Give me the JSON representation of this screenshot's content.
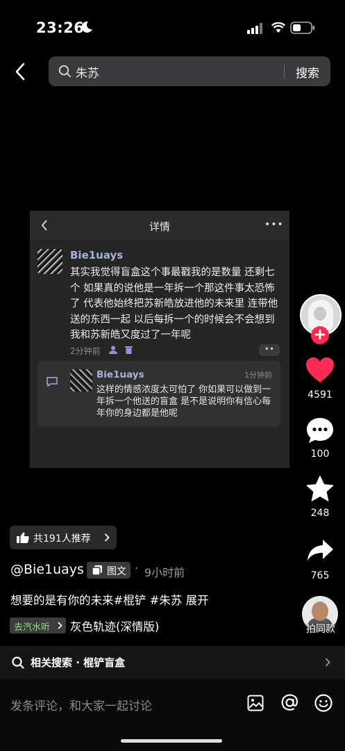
{
  "status_bar": {
    "time": "23:26"
  },
  "search": {
    "query": "朱苏",
    "button": "搜索"
  },
  "embedded_screenshot": {
    "title": "详情",
    "more": "•••",
    "comment": {
      "username": "Bie1uays",
      "text": "其实我觉得盲盒这个事最戳我的是数量 还剩七个 如果真的说他是一年拆一个那这件事太恐怖了 代表他始终把苏新皓放进他的未来里 连带他送的东西一起 以后每拆一个的时候会不会想到我和苏新皓又度过了一年呢",
      "time": "2分钟前",
      "more": "••"
    },
    "reply": {
      "username": "Bie1uays",
      "time": "1分钟前",
      "text": "这样的情感浓度太可怕了 你如果可以做到一年拆一个他送的盲盒 是不是说明你有信心每年你的身边都是他呢"
    }
  },
  "actions": {
    "likes": "4591",
    "comments": "100",
    "favorites": "248",
    "shares": "765"
  },
  "recommend": {
    "label": "共191人推荐"
  },
  "post": {
    "author": "@Bie1uays",
    "type_badge": "图文",
    "dot": "·",
    "time_ago": "9小时前",
    "description": "想要的是有你的未来#棍铲 #朱苏  展开"
  },
  "music": {
    "tag": "去汽水听",
    "song": "灰色轨迹(深情版)",
    "use_label": "拍同款"
  },
  "related_search": {
    "label": "相关搜索 · 棍铲盲盒"
  },
  "comment_bar": {
    "placeholder": "发条评论，和大家一起讨论"
  },
  "colors": {
    "like": "#fe2c55",
    "username": "#a9b3d6",
    "music_tag": "#8fe08a"
  },
  "icons": [
    "moon-icon",
    "signal-icon",
    "wifi-icon",
    "battery-icon",
    "back-icon",
    "search-icon",
    "heart-icon",
    "comment-icon",
    "star-icon",
    "share-icon",
    "thumb-up-icon",
    "image-icon",
    "at-icon",
    "emoji-icon"
  ]
}
